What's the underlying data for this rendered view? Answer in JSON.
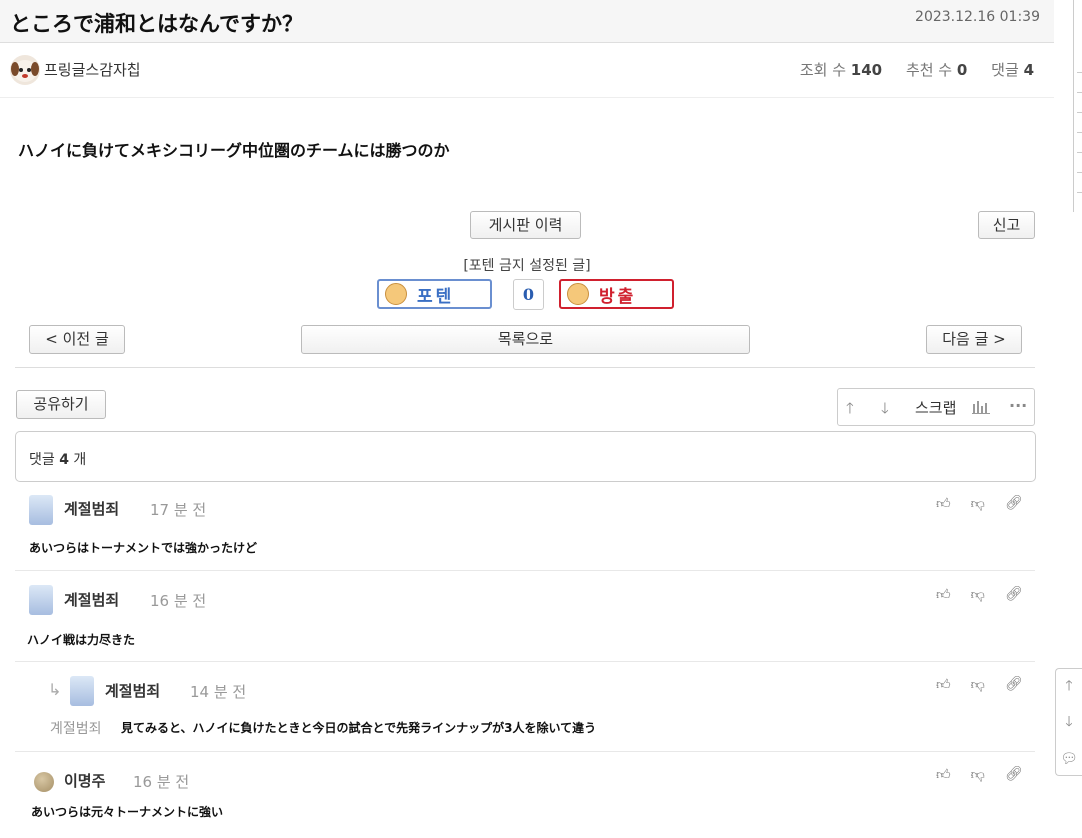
{
  "post": {
    "title": "ところで浦和とはなんですか？",
    "datetime": "2023.12.16 01:39",
    "author": "프링글스감자칩",
    "views_label": "조회 수",
    "views": "140",
    "recommend_label": "추천 수",
    "recommend": "0",
    "comments_label": "댓글",
    "comments": "4",
    "body": "ハノイに負けてメキシコリーグ中位圏のチームには勝つのか"
  },
  "actions": {
    "history": "게시판 이력",
    "report": "신고",
    "notice": "[포텐 금지 설정된 글]",
    "upvote": "포텐",
    "vote_count": "0",
    "downvote": "방출",
    "prev": "< 이전 글",
    "list": "목록으로",
    "next": "다음 글 >",
    "share": "공유하기",
    "scrap": "스크랩"
  },
  "comment_section": {
    "label": "댓글",
    "count": "4",
    "unit": "개"
  },
  "comments": [
    {
      "name": "계절범죄",
      "time": "17 분 전",
      "text": "あいつらはトーナメントでは強かったけど"
    },
    {
      "name": "계절범죄",
      "time": "16 분 전",
      "text": "ハノイ戦は力尽きた"
    },
    {
      "name": "계절범죄",
      "time": "14 분 전",
      "reply_to": "계절범죄",
      "text": "見てみると、ハノイに負けたときと今日の試合とで先発ラインナップが3人を除いて違う"
    },
    {
      "name": "이명주",
      "time": "16 분 전",
      "text": "あいつらは元々トーナメントに強い"
    }
  ],
  "colors": {
    "upvote": "#3a6fc4",
    "downvote": "#d0202e",
    "accent_text": "#111111"
  },
  "icons": [
    "thumbs-up-icon",
    "thumbs-down-icon",
    "link-icon",
    "arrow-up-icon",
    "arrow-down-icon",
    "chart-icon",
    "more-icon",
    "reply-arrow-icon",
    "chat-bubble-icon"
  ]
}
